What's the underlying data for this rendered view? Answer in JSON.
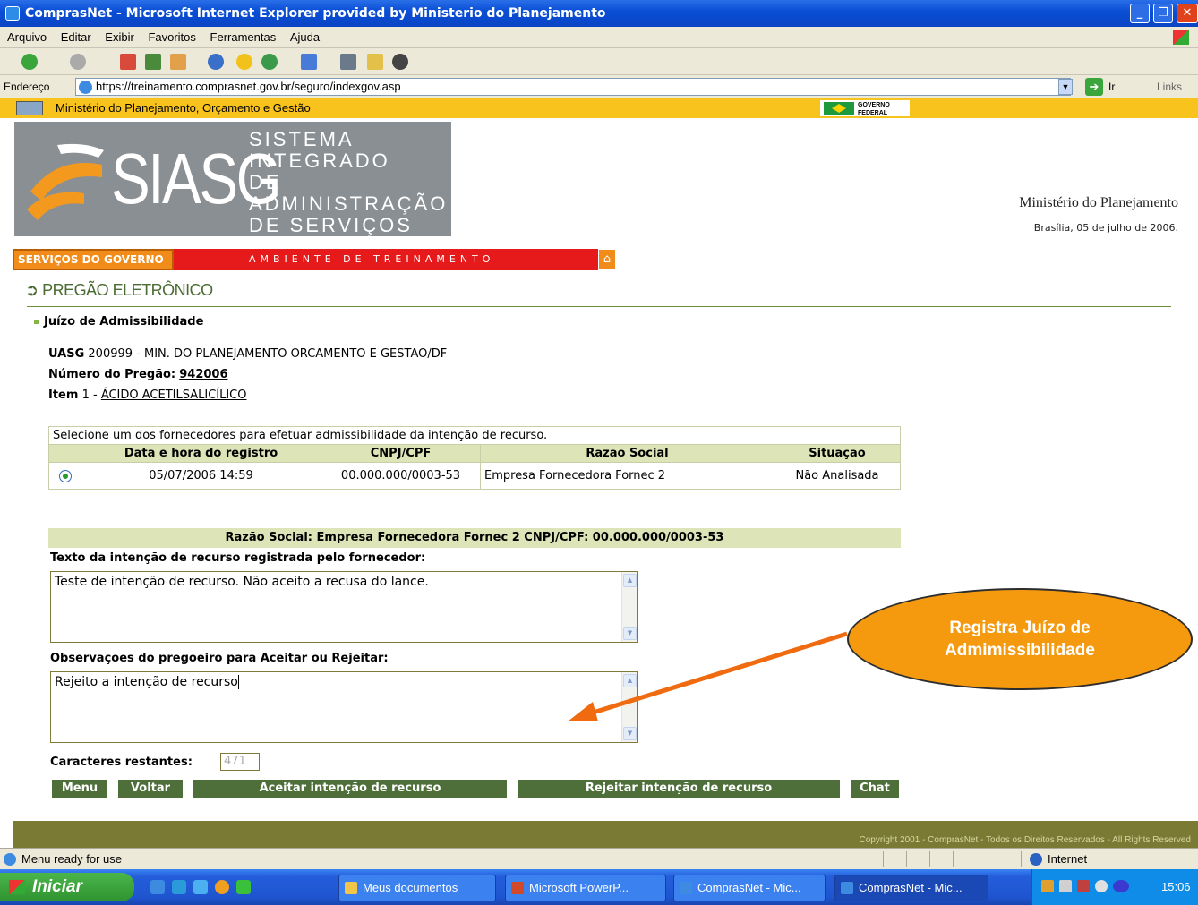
{
  "window": {
    "title": "ComprasNet - Microsoft Internet Explorer provided by Ministerio do Planejamento"
  },
  "menu": [
    "Arquivo",
    "Editar",
    "Exibir",
    "Favoritos",
    "Ferramentas",
    "Ajuda"
  ],
  "address": {
    "label": "Endereço",
    "url": "https://treinamento.comprasnet.gov.br/seguro/indexgov.asp",
    "go_label": "Ir",
    "links_label": "Links"
  },
  "ministry_bar": {
    "name": "Ministério do Planejamento, Orçamento e Gestão",
    "gov_logo_text": "GOVERNO FEDERAL"
  },
  "banner": {
    "logo_word": "SIASG",
    "logo_line1": "SISTEMA INTEGRADO",
    "logo_line2": "DE ADMINISTRAÇÃO",
    "logo_line3": "DE SERVIÇOS GERAIS",
    "ministry": "Ministério do Planejamento",
    "date": "Brasília, 05 de julho de 2006."
  },
  "service_bar": {
    "gov_label": "SERVIÇOS DO GOVERNO",
    "environment": "AMBIENTE DE TREINAMENTO"
  },
  "section_title": "PREGÃO ELETRÔNICO",
  "subsection_title": "Juízo de Admissibilidade",
  "info": {
    "uasg_label": "UASG",
    "uasg_value": "200999 - MIN. DO PLANEJAMENTO ORCAMENTO E GESTAO/DF",
    "pregao_label": "Número do Pregão:",
    "pregao_value": "942006",
    "item_label": "Item",
    "item_number": "1 -",
    "item_value": "ÁCIDO ACETILSALICÍLICO"
  },
  "table": {
    "caption": "Selecione um dos fornecedores para efetuar admissibilidade da intenção de recurso.",
    "headers": [
      "Data e hora do registro",
      "CNPJ/CPF",
      "Razão Social",
      "Situação"
    ],
    "rows": [
      {
        "datetime": "05/07/2006 14:59",
        "cnpj": "00.000.000/0003-53",
        "razao": "Empresa Fornecedora Fornec 2",
        "situacao": "Não Analisada",
        "selected": true
      }
    ]
  },
  "selected_bar": "Razão Social:  Empresa Fornecedora Fornec 2 CNPJ/CPF: 00.000.000/0003-53",
  "intent": {
    "label": "Texto da intenção de recurso registrada pelo fornecedor:",
    "text": "Teste de intenção de recurso. Não aceito a recusa do lance."
  },
  "observations": {
    "label": "Observações do pregoeiro para Aceitar ou Rejeitar:",
    "text": "Rejeito a intenção de recurso"
  },
  "chars": {
    "label": "Caracteres restantes:",
    "value": "471"
  },
  "buttons": {
    "menu": "Menu",
    "voltar": "Voltar",
    "aceitar": "Aceitar intenção de recurso",
    "rejeitar": "Rejeitar intenção de recurso",
    "chat": "Chat"
  },
  "footer": "Copyright 2001 - ComprasNet - Todos os Direitos Reservados - All Rights Reserved",
  "status": {
    "text": "Menu ready for use",
    "zone": "Internet"
  },
  "callout": {
    "line1": "Registra Juízo de",
    "line2": "Admimissibilidade"
  },
  "taskbar": {
    "start": "Iniciar",
    "tasks": [
      "Meus documentos",
      "Microsoft PowerP...",
      "ComprasNet - Mic...",
      "ComprasNet - Mic..."
    ],
    "clock": "15:06"
  },
  "colors": {
    "accent_green": "#4e6f3a",
    "header_bg": "#dde4b8",
    "ministry_yellow": "#f9c31e",
    "service_red": "#e61a1a",
    "callout_orange": "#f59a0f"
  }
}
